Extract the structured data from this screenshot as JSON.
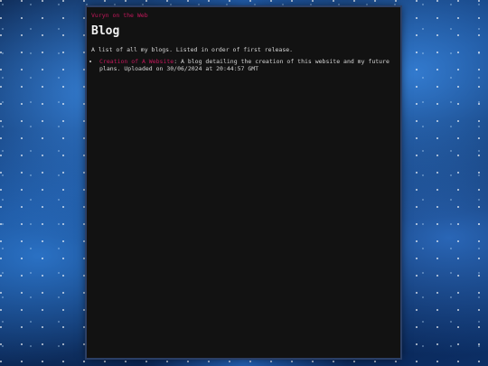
{
  "header": {
    "site_link": "Vuryn on the Web"
  },
  "main": {
    "title": "Blog",
    "intro": "A list of all my blogs. Listed in order of first release.",
    "posts": [
      {
        "title": "Creation of A Website",
        "description": ": A blog detailing the creation of this website and my future plans. Uploaded on 30/06/2024 at 20:44:57 GMT"
      }
    ]
  },
  "colors": {
    "accent_link": "#c2185b",
    "panel_background": "#121212",
    "text": "#d6d6d6"
  }
}
